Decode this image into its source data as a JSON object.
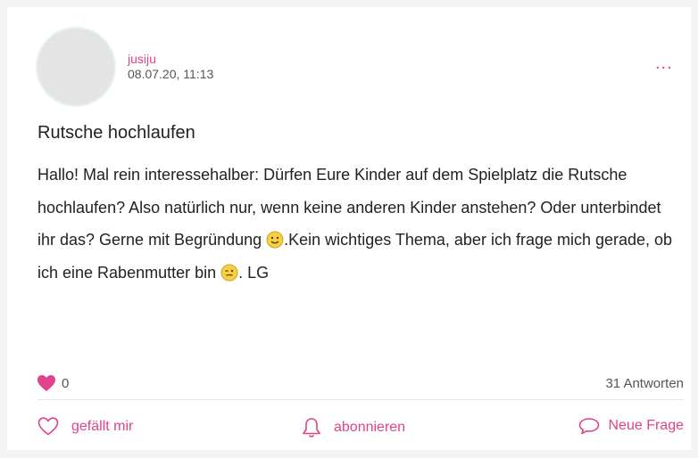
{
  "post": {
    "username": "jusiju",
    "timestamp": "08.07.20, 11:13",
    "more_label": "...",
    "title": "Rutsche hochlaufen",
    "body_part1": "Hallo! Mal rein interessehalber: Dürfen Eure Kinder auf dem Spielplatz die Rutsche hochlaufen? Also natürlich nur, wenn keine anderen Kinder anstehen? Oder unterbindet ihr das? Gerne mit Begründung ",
    "body_part2": ".Kein wichtiges Thema, aber ich frage mich gerade, ob ich eine Rabenmutter bin ",
    "body_part3": ". LG",
    "emoji1": "smile",
    "emoji2": "wink",
    "likes_count": "0",
    "answers": "31 Antworten"
  },
  "actions": {
    "like_label": "gefällt mir",
    "subscribe_label": "abonnieren",
    "new_question_label": "Neue Frage"
  },
  "colors": {
    "accent": "#e0428b",
    "divider": "#ddeeea"
  },
  "icons": {
    "like": "heart-icon",
    "subscribe": "bell-icon",
    "new_question": "speech-bubble-icon"
  }
}
